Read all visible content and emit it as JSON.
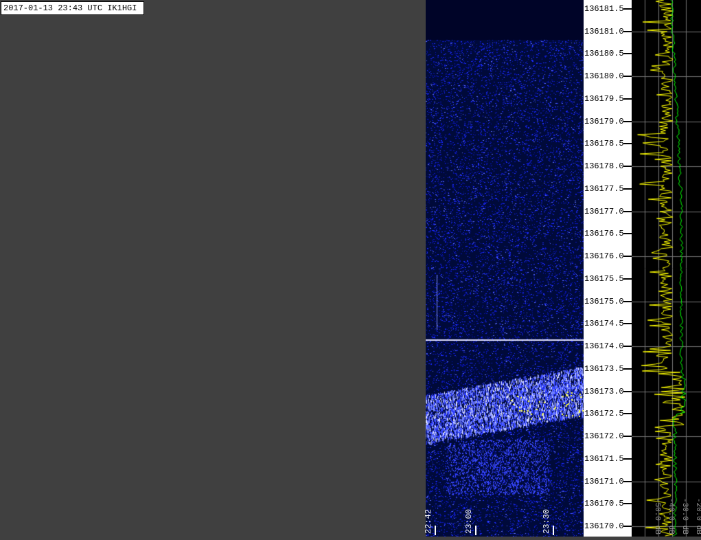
{
  "header": {
    "stamp": "2017-01-13 23:43 UTC IK1HGI"
  },
  "frequency_axis": {
    "labels": [
      "136181.5",
      "136181.0",
      "136180.5",
      "136180.0",
      "136179.5",
      "136179.0",
      "136178.5",
      "136178.0",
      "136177.5",
      "136177.0",
      "136176.5",
      "136176.0",
      "136175.5",
      "136175.0",
      "136174.5",
      "136174.0",
      "136173.5",
      "136173.0",
      "136172.5",
      "136172.0",
      "136171.5",
      "136171.0",
      "136170.5",
      "136170.0"
    ]
  },
  "time_axis": {
    "labels": [
      "22:42",
      "23:00",
      "23:30"
    ]
  },
  "level_axis": {
    "labels": [
      "-50.0 dB",
      "-40.0 dB",
      "-30.0 dB",
      "-20.0 dB"
    ]
  },
  "colors": {
    "background": "#404040",
    "waterfall": "#000a3a",
    "signal": "#2030ff",
    "spectrum_peak": "#ffff00",
    "spectrum_avg": "#00ff00"
  }
}
